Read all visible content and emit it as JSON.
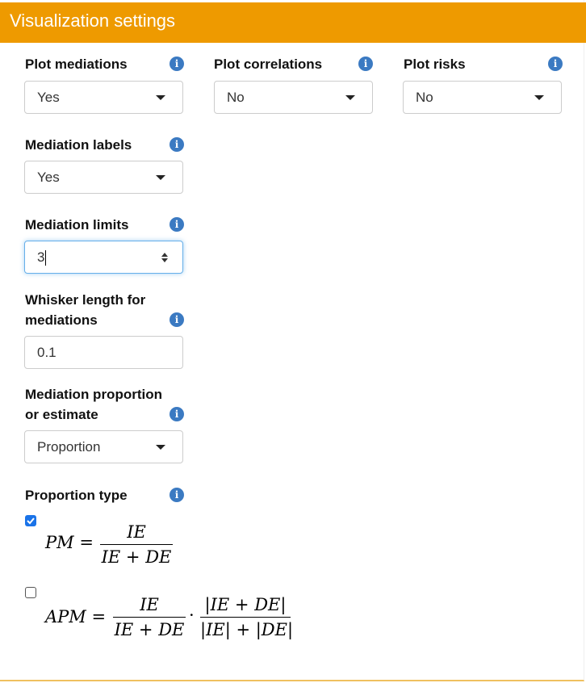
{
  "header": {
    "title": "Visualization settings"
  },
  "fields": {
    "plot_mediations": {
      "label": "Plot mediations",
      "value": "Yes"
    },
    "plot_correlations": {
      "label": "Plot correlations",
      "value": "No"
    },
    "plot_risks": {
      "label": "Plot risks",
      "value": "No"
    },
    "mediation_labels": {
      "label": "Mediation labels",
      "value": "Yes"
    },
    "mediation_limits": {
      "label": "Mediation limits",
      "value": "3"
    },
    "whisker_length": {
      "label_line1": "Whisker length for",
      "label_line2": "mediations",
      "value": "0.1"
    },
    "mediation_proportion": {
      "label_line1": "Mediation proportion",
      "label_line2": "or estimate",
      "value": "Proportion"
    },
    "proportion_type": {
      "label": "Proportion type",
      "options": [
        {
          "checked": true,
          "lhs": "PM",
          "num": "IE",
          "den": "IE + DE"
        },
        {
          "checked": false,
          "lhs": "APM",
          "num": "IE",
          "den": "IE + DE",
          "num2": "|IE + DE|",
          "den2": "|IE| + |DE|"
        }
      ]
    }
  },
  "icons": {
    "info": "info-icon",
    "caret": "caret-down-icon",
    "spinner": "spinner-arrows-icon",
    "check": "check-icon"
  },
  "colors": {
    "header_bg": "#ee9a00",
    "info_bg": "#3b7ac2",
    "checkbox": "#1a73e8",
    "focus_border": "#66afe9"
  }
}
